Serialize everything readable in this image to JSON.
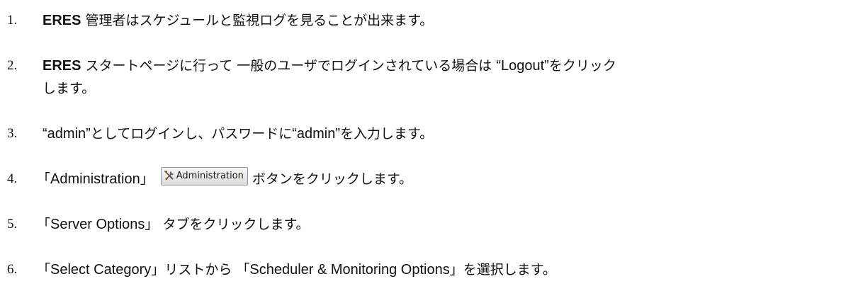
{
  "steps": [
    {
      "number": "1.",
      "parts": [
        {
          "text": "ERES",
          "style": "sans-bold"
        },
        {
          "text": " 管理者はスケジュールと監視ログを見ることが出来ます。",
          "style": "jp"
        }
      ]
    },
    {
      "number": "2.",
      "parts": [
        {
          "text": "ERES",
          "style": "sans-bold"
        },
        {
          "text": " スタートページに行って 一般のユーザでログインされている場合は ",
          "style": "jp"
        },
        {
          "text": "“Logout”",
          "style": "sans"
        },
        {
          "text": "をクリック",
          "style": "jp"
        }
      ],
      "continuation": "します。"
    },
    {
      "number": "3.",
      "parts": [
        {
          "text": "“admin”",
          "style": "sans"
        },
        {
          "text": "としてログインし、パスワードに",
          "style": "jp"
        },
        {
          "text": "“admin”",
          "style": "sans"
        },
        {
          "text": "を入力します。",
          "style": "jp"
        }
      ]
    },
    {
      "number": "4.",
      "parts_before": [
        {
          "text": "「",
          "style": "jp"
        },
        {
          "text": "Administration",
          "style": "sans"
        },
        {
          "text": "」",
          "style": "jp"
        }
      ],
      "button": {
        "icon": "tools-icon",
        "label": "Administration"
      },
      "parts_after": [
        {
          "text": "ボタンをクリックします。",
          "style": "jp"
        }
      ]
    },
    {
      "number": "5.",
      "parts": [
        {
          "text": "「",
          "style": "jp"
        },
        {
          "text": "Server Options",
          "style": "sans"
        },
        {
          "text": "」 タブをクリックします。",
          "style": "jp"
        }
      ]
    },
    {
      "number": "6.",
      "parts": [
        {
          "text": "「",
          "style": "jp"
        },
        {
          "text": "Select Category",
          "style": "sans"
        },
        {
          "text": "」リストから 「",
          "style": "jp"
        },
        {
          "text": "Scheduler & Monitoring Options",
          "style": "sans"
        },
        {
          "text": "」を選択します。",
          "style": "jp"
        }
      ]
    }
  ]
}
